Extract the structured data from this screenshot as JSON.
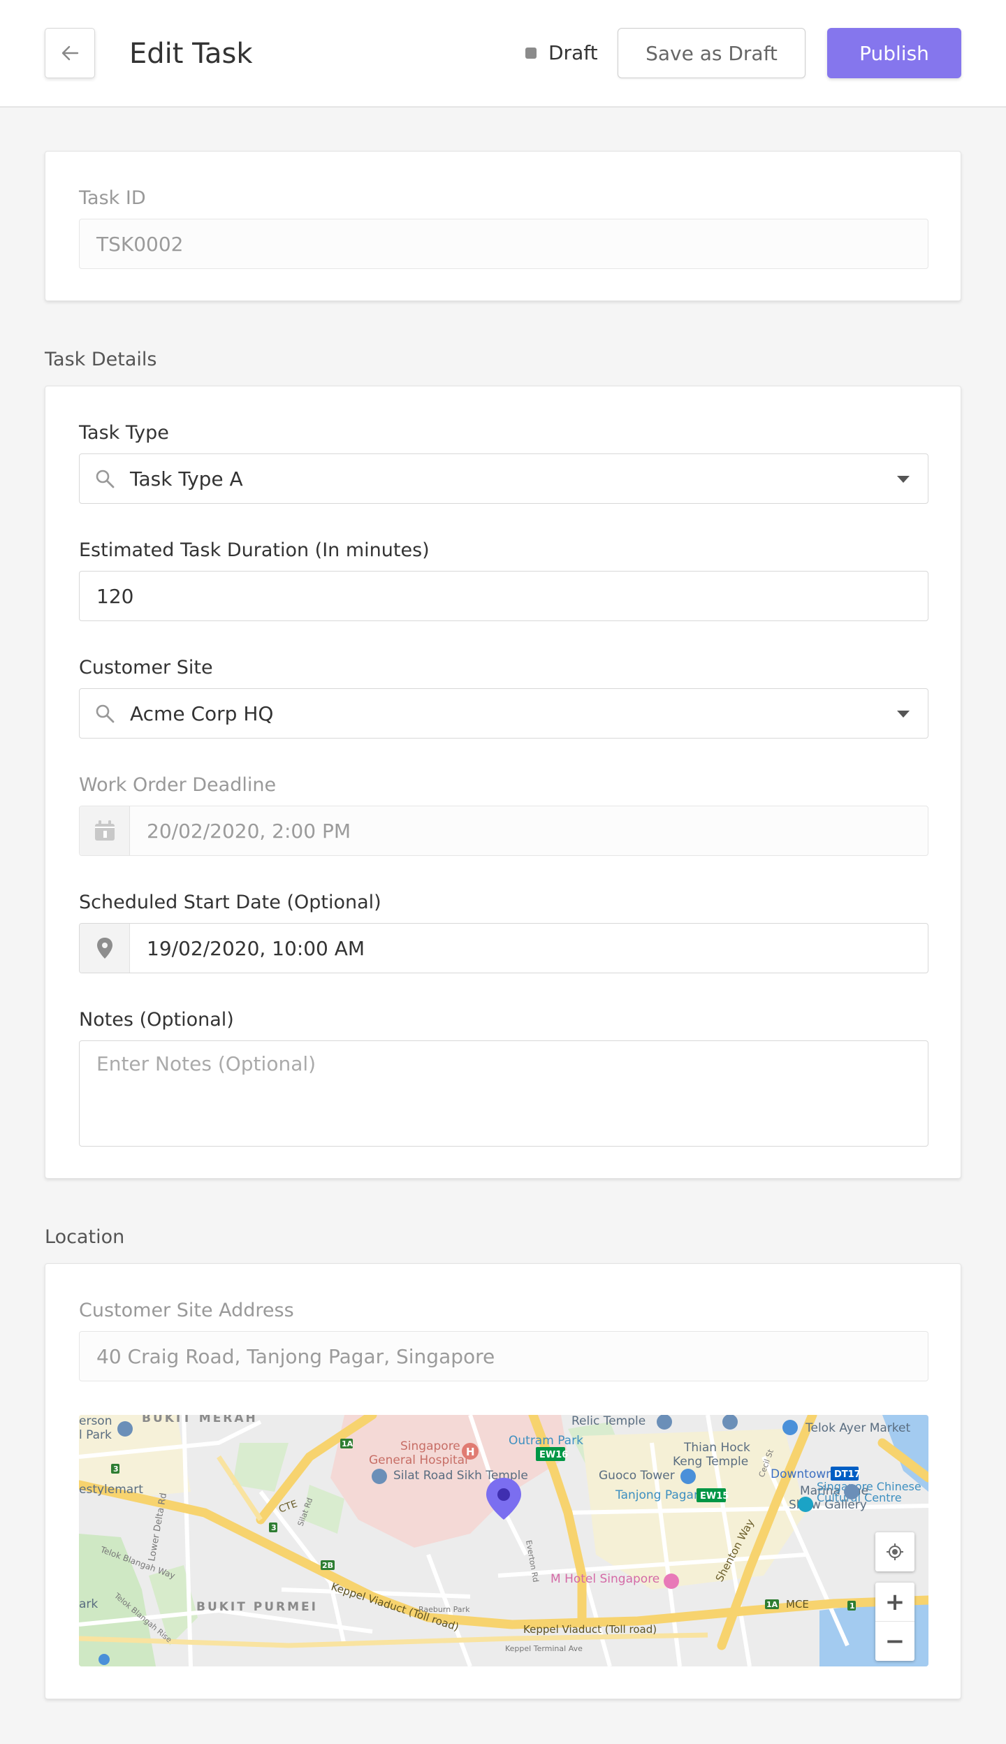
{
  "header": {
    "title": "Edit Task",
    "status": "Draft",
    "save_draft_label": "Save as Draft",
    "publish_label": "Publish"
  },
  "task_id": {
    "label": "Task ID",
    "value": "TSK0002"
  },
  "task_details": {
    "section_title": "Task Details",
    "task_type": {
      "label": "Task Type",
      "value": "Task Type A"
    },
    "duration": {
      "label": "Estimated Task Duration (In minutes)",
      "value": "120"
    },
    "customer_site": {
      "label": "Customer Site",
      "value": "Acme Corp HQ"
    },
    "deadline": {
      "label": "Work Order Deadline",
      "value": "20/02/2020, 2:00 PM"
    },
    "start_date": {
      "label": "Scheduled Start Date (Optional)",
      "value": "19/02/2020, 10:00 AM"
    },
    "notes": {
      "label": "Notes (Optional)",
      "placeholder": "Enter Notes (Optional)"
    }
  },
  "location": {
    "section_title": "Location",
    "address_label": "Customer Site Address",
    "address_value": "40 Craig Road, Tanjong Pagar, Singapore",
    "map": {
      "labels": {
        "bukit_merah": "BUKIT MERAH",
        "erson": "erson",
        "park": "l Park",
        "estylemart": "estylemart",
        "sgh_1": "Singapore",
        "sgh_2": "General Hospital",
        "outram": "Outram Park",
        "ew16": "EW16",
        "relic": "Relic Temple",
        "telok_ayer": "Telok Ayer Market",
        "thian_1": "Thian Hock",
        "thian_2": "Keng Temple",
        "downtown": "Downtown",
        "dt17": "DT17",
        "marina_1": "Marina One",
        "marina_2": "Show Gallery",
        "cte": "CTE",
        "silat": "Silat Road Sikh Temple",
        "guoco": "Guoco Tower",
        "tanjong": "Tanjong Pagar",
        "ew15": "EW15",
        "chinese_1": "Singapore Chinese",
        "chinese_2": "Cultural Centre",
        "shenton": "Shenton Way",
        "lower_delta": "Lower Delta Rd",
        "telok_blangah": "Telok Blangah Way",
        "m_hotel": "M Hotel Singapore",
        "ark": "ark",
        "bukit_purmei": "BUKIT PURMEI",
        "keppel_1": "Keppel Viaduct (Toll road)",
        "keppel_2": "Keppel Viaduct (Toll road)",
        "mce": "MCE",
        "raeburn": "Raeburn Park",
        "keppel_terminal": "Keppel Terminal Ave",
        "blangah_rise": "Telok Blangah Rise",
        "silat_rd": "Silat Rd",
        "everton": "Everton Rd",
        "cecil": "Cecil St",
        "r1a": "1A",
        "r3": "3",
        "r2b": "2B",
        "r1a_2": "1A",
        "r1": "1"
      },
      "zoom_in": "+",
      "zoom_out": "−"
    }
  },
  "colors": {
    "accent": "#8576ed",
    "status_dot": "#8b8b8b",
    "pin": "#7b6ef0"
  }
}
